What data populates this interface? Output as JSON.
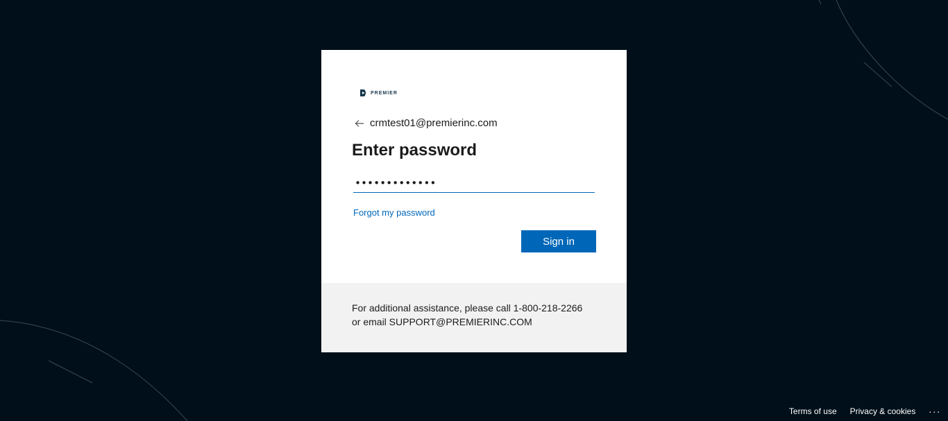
{
  "logo": {
    "text": "PREMIER"
  },
  "identity": {
    "email": "crmtest01@premierinc.com",
    "back_icon": "arrow-left-icon"
  },
  "title": "Enter password",
  "password": {
    "value": "•••••••••••••"
  },
  "links": {
    "forgot": "Forgot my password"
  },
  "buttons": {
    "sign_in": "Sign in"
  },
  "assistance": {
    "line1": "For additional assistance, please call 1-800-218-2266",
    "line2": "or email SUPPORT@PREMIERINC.COM"
  },
  "footer": {
    "terms": "Terms of use",
    "privacy": "Privacy & cookies",
    "more": "..."
  },
  "colors": {
    "background": "#000f19",
    "accent": "#0067b8",
    "card": "#ffffff",
    "card_footer": "#f2f2f2"
  }
}
